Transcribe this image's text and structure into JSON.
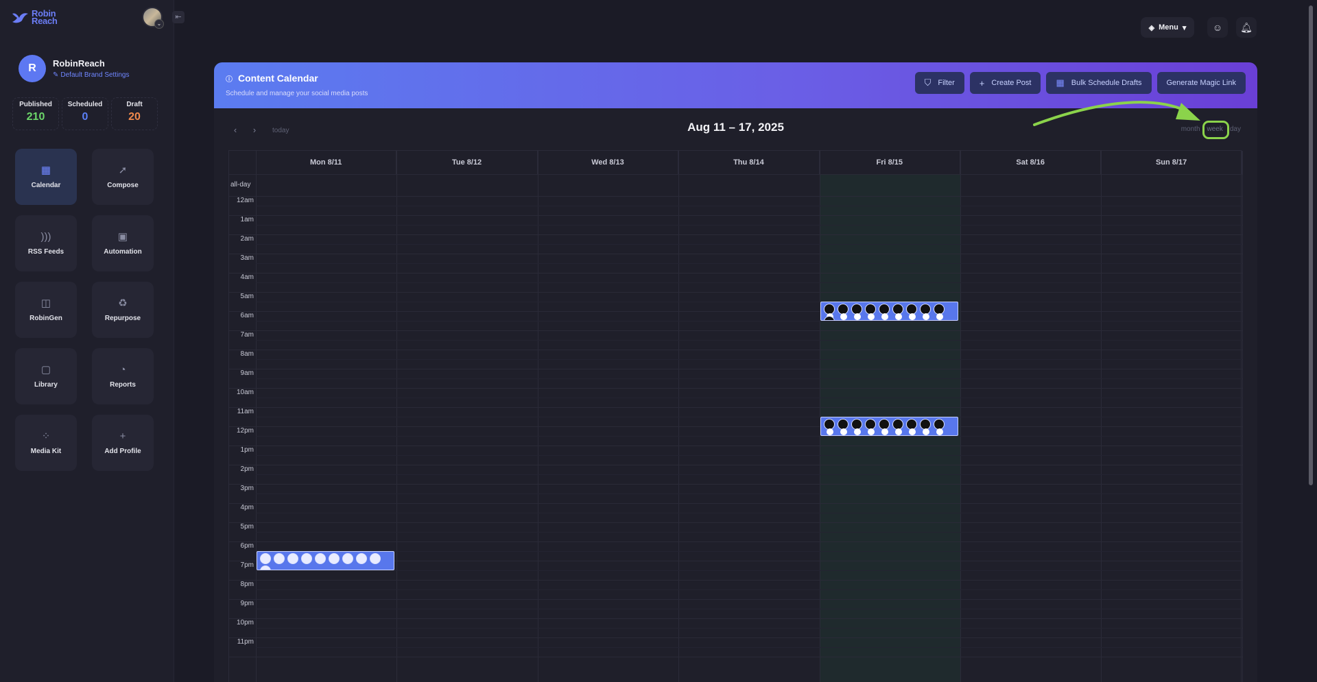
{
  "brand": {
    "name": "Robin\nReach",
    "line1": "Robin",
    "line2": "Reach"
  },
  "profile": {
    "initial": "R",
    "name": "RobinReach",
    "settings_link": "Default Brand Settings"
  },
  "stats": [
    {
      "label": "Published",
      "value": "210",
      "color": "#6cd76a"
    },
    {
      "label": "Scheduled",
      "value": "0",
      "color": "#5b7ff7"
    },
    {
      "label": "Draft",
      "value": "20",
      "color": "#f0894c"
    }
  ],
  "nav": [
    {
      "label": "Calendar",
      "icon": "calendar-icon",
      "glyph": "▦",
      "active": true
    },
    {
      "label": "Compose",
      "icon": "rocket-icon",
      "glyph": "➚"
    },
    {
      "label": "RSS Feeds",
      "icon": "rss-icon",
      "glyph": ")))"
    },
    {
      "label": "Automation",
      "icon": "robot-icon",
      "glyph": "▣"
    },
    {
      "label": "RobinGen",
      "icon": "sticky-note-icon",
      "glyph": "◫"
    },
    {
      "label": "Repurpose",
      "icon": "recycle-icon",
      "glyph": "♻"
    },
    {
      "label": "Library",
      "icon": "folder-icon",
      "glyph": "▢"
    },
    {
      "label": "Reports",
      "icon": "chart-icon",
      "glyph": "◔"
    },
    {
      "label": "Media Kit",
      "icon": "grid-icon",
      "glyph": "⁘"
    },
    {
      "label": "Add Profile",
      "icon": "plus-icon",
      "glyph": "+"
    }
  ],
  "topbar": {
    "menu_label": "Menu"
  },
  "calendar": {
    "title": "Content Calendar",
    "subtitle": "Schedule and manage your social media posts",
    "buttons": {
      "filter": "Filter",
      "create": "Create Post",
      "bulk": "Bulk Schedule Drafts",
      "magic": "Generate Magic Link"
    },
    "today_label": "today",
    "range": "Aug 11 – 17, 2025",
    "views": {
      "month": "month",
      "week": "week",
      "day": "day"
    },
    "days": [
      "Mon 8/11",
      "Tue 8/12",
      "Wed 8/13",
      "Thu 8/14",
      "Fri 8/15",
      "Sat 8/16",
      "Sun 8/17"
    ],
    "allday_label": "all-day",
    "hours": [
      "12am",
      "1am",
      "2am",
      "3am",
      "4am",
      "5am",
      "6am",
      "7am",
      "8am",
      "9am",
      "10am",
      "11am",
      "12pm",
      "1pm",
      "2pm",
      "3pm",
      "4pm",
      "5pm",
      "6pm",
      "7pm",
      "8pm",
      "9pm",
      "10pm",
      "11pm"
    ],
    "events": [
      {
        "day": 4,
        "hour": 6,
        "count": 10
      },
      {
        "day": 4,
        "hour": 12,
        "count": 9
      },
      {
        "day": 0,
        "hour": 19,
        "count": 10
      }
    ]
  },
  "colors": {
    "accent": "#5b7cf0",
    "highlight": "#8bd34b"
  }
}
